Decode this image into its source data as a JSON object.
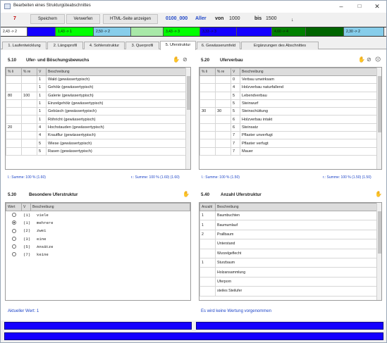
{
  "window": {
    "title": "Bearbeiten eines Strukturgüteabschnittes"
  },
  "toolbar": {
    "record_no": "7",
    "save_label": "Speichern",
    "discard_label": "Verwerfen",
    "html_label": "HTML-Seite anzeigen",
    "code": "0100_000",
    "code_type": "Aller",
    "from_label": "von",
    "from_value": "1000",
    "to_label": "bis",
    "to_value": "1500"
  },
  "segments": [
    {
      "label": "2,43 -> 2",
      "color": "#ffffff"
    },
    {
      "label": "",
      "color": "#1400ff"
    },
    {
      "label": "1,43 -> 1",
      "color": "#00ff00"
    },
    {
      "label": "2,50 -> 2",
      "color": "#87cdea"
    },
    {
      "label": "",
      "color": "#a8e8a8"
    },
    {
      "label": "3,43 -> 3",
      "color": "#00ff00"
    },
    {
      "label": "3,33 -> 3",
      "color": "#1400ff"
    },
    {
      "label": "",
      "color": "#1400ff"
    },
    {
      "label": "4,60 -> 4",
      "color": "#008000"
    },
    {
      "label": "",
      "color": "#006400"
    },
    {
      "label": "2,30 -> 2",
      "color": "#87cdea"
    }
  ],
  "tabs": [
    "1. Laufentwicklung",
    "2. Längsprofil",
    "4. Sohlenstruktur",
    "3. Querprofil",
    "5. Uferstruktur",
    "6. Gewässerumfeld",
    "Ergänzungen des Abschnittes"
  ],
  "panel_510": {
    "code": "5.10",
    "title": "Ufer- und Böschungsbewuchs",
    "headers": [
      "% li",
      "% re",
      "V",
      "Beschreibung"
    ],
    "rows": [
      [
        "",
        "",
        "1",
        "Wald (gewässertypisch)"
      ],
      [
        "",
        "",
        "1",
        "Gehölz (gewässertypisch)"
      ],
      [
        "80",
        "100",
        "1",
        "Galerie (gewässertypisch)"
      ],
      [
        "",
        "",
        "1",
        "Einzelgehölz (gewässertypisch)"
      ],
      [
        "",
        "",
        "1",
        "Gebüsch (gewässertypisch)"
      ],
      [
        "",
        "",
        "1",
        "Röhricht (gewässertypisch)"
      ],
      [
        "20",
        "",
        "4",
        "Hochstauden (gewässertypisch)"
      ],
      [
        "",
        "",
        "4",
        "Krautflur (gewässertypisch)"
      ],
      [
        "",
        "",
        "5",
        "Wiese (gewässertypisch)"
      ],
      [
        "",
        "",
        "5",
        "Rasen (gewässertypisch)"
      ]
    ],
    "sum_left": "l.: Summe: 100 % (1.60)",
    "sum_right": "r.: Summe: 100 % (1.60) (1.60)"
  },
  "panel_520": {
    "code": "5.20",
    "title": "Uferverbau",
    "headers": [
      "% li",
      "% re",
      "V",
      "Beschreibung"
    ],
    "rows": [
      [
        "",
        "",
        "0",
        "Verbau unwirksam"
      ],
      [
        "",
        "",
        "4",
        "Holzverbau naturfallend"
      ],
      [
        "",
        "",
        "5",
        "Lebendverbau"
      ],
      [
        "",
        "",
        "5",
        "Steinwurf"
      ],
      [
        "30",
        "30",
        "5",
        "Steinschüttung"
      ],
      [
        "",
        "",
        "6",
        "Holzverbau intakt"
      ],
      [
        "",
        "",
        "6",
        "Steinsatz"
      ],
      [
        "",
        "",
        "7",
        "Pflaster unverfugt"
      ],
      [
        "",
        "",
        "7",
        "Pflaster verfugt"
      ],
      [
        "",
        "",
        "7",
        "Mauer"
      ]
    ],
    "sum_left": "l.: Summe: 100 % (1.50)",
    "sum_right": "r.: Summe: 100 % (1.50) (1.50)"
  },
  "panel_530": {
    "code": "5.30",
    "title": "Besondere Uferstruktur",
    "headers": [
      "Wert",
      "V",
      "Beschreibung"
    ],
    "rows": [
      {
        "selected": false,
        "v": "(1)",
        "desc": "viele"
      },
      {
        "selected": true,
        "v": "(1)",
        "desc": "mehrere"
      },
      {
        "selected": false,
        "v": "(2)",
        "desc": "zwei"
      },
      {
        "selected": false,
        "v": "(3)",
        "desc": "eine"
      },
      {
        "selected": false,
        "v": "(5)",
        "desc": "Ansätze"
      },
      {
        "selected": false,
        "v": "(7)",
        "desc": "keine"
      }
    ],
    "current_value": "Aktueller Wert: 1"
  },
  "panel_540": {
    "code": "5.40",
    "title": "Anzahl Uferstruktur",
    "headers": [
      "Anzahl",
      "Beschreibung"
    ],
    "rows": [
      [
        "1",
        "Baumbuchten"
      ],
      [
        "1",
        "Baumumlauf"
      ],
      [
        "2",
        "Prallbaum"
      ],
      [
        "",
        "Unterstand"
      ],
      [
        "",
        "Wurzelgeflecht"
      ],
      [
        "1",
        "Sturzbaum"
      ],
      [
        "",
        "Holzansammlung"
      ],
      [
        "",
        "Uferporn"
      ],
      [
        "",
        "steiles Steilufer"
      ]
    ],
    "status": "Es wird keine Wertung vorgenommen"
  }
}
